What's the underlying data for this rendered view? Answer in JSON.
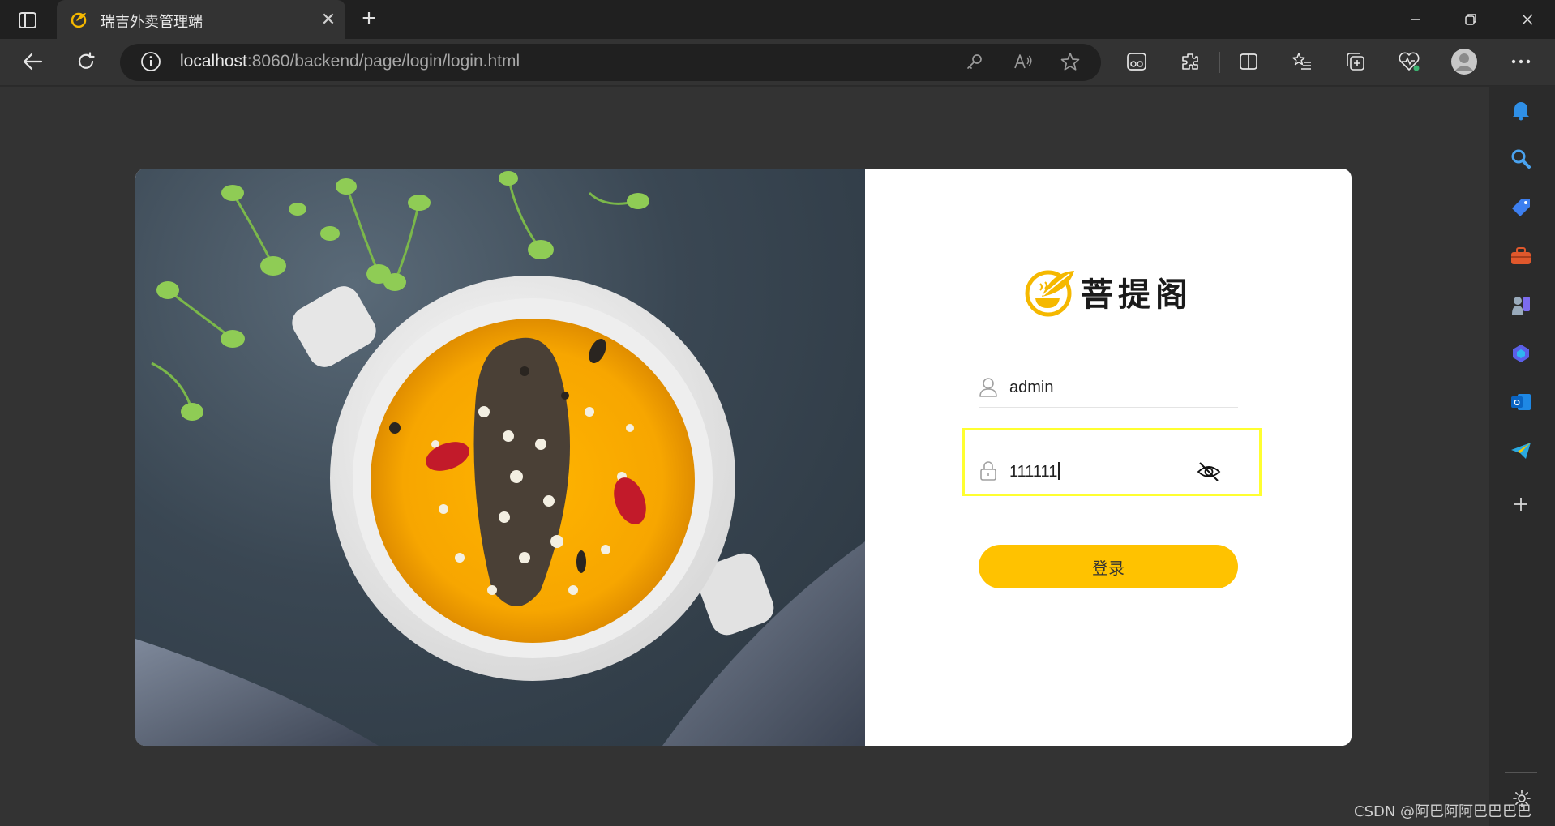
{
  "browser": {
    "tab_title": "瑞吉外卖管理端",
    "url_host": "localhost",
    "url_path": ":8060/backend/page/login/login.html",
    "theme": "dark"
  },
  "login": {
    "brand_name": "菩提阁",
    "username_value": "admin",
    "password_value": "111111",
    "login_button_label": "登录",
    "accent_color": "#ffc200",
    "highlight_color": "#ffff30"
  },
  "watermark": "CSDN @阿巴阿阿巴巴巴巴",
  "icons": {
    "toolbar": [
      "back-icon",
      "refresh-icon",
      "info-icon",
      "key-icon",
      "read-aloud-icon",
      "favorite-star-icon",
      "immersive-reader-icon",
      "extensions-icon",
      "split-screen-icon",
      "favorites-icon",
      "collections-icon",
      "browser-essentials-icon",
      "profile-avatar-icon",
      "more-options-icon"
    ],
    "siderail": [
      "bell-icon",
      "search-icon",
      "shopping-tag-icon",
      "tools-icon",
      "games-icon",
      "copilot-icon",
      "outlook-icon",
      "telegram-icon",
      "add-icon",
      "settings-icon"
    ],
    "form": [
      "user-icon",
      "lock-icon",
      "eye-slash-icon"
    ]
  }
}
